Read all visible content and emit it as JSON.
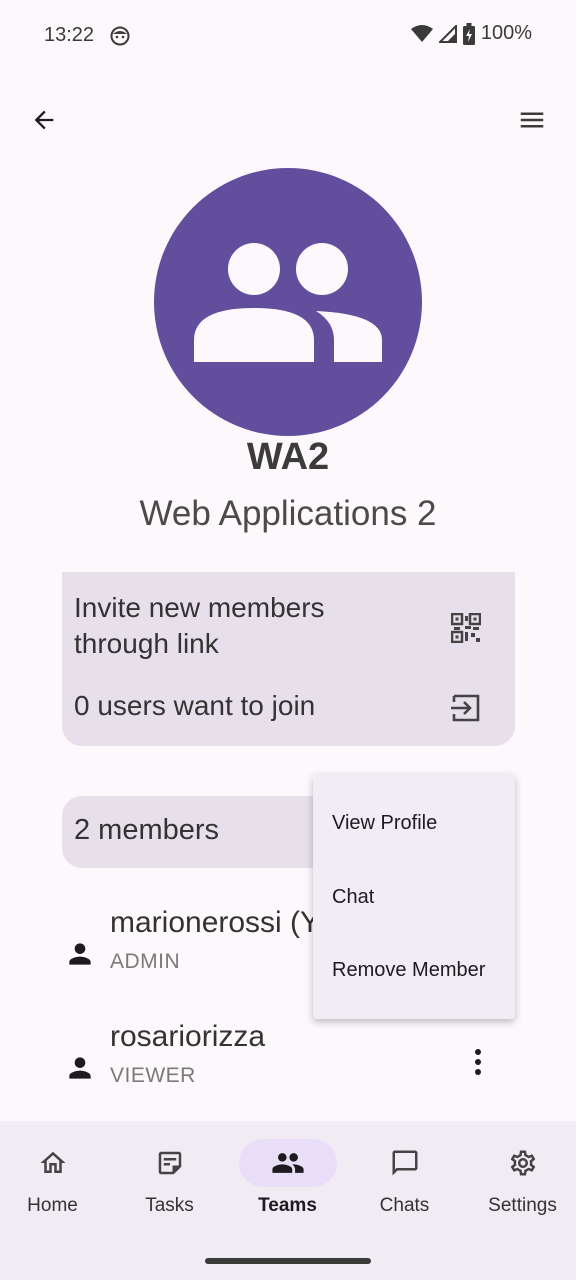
{
  "status_bar": {
    "time": "13:22",
    "battery": "100%"
  },
  "team": {
    "code": "WA2",
    "name": "Web Applications 2"
  },
  "invite": {
    "title": "Invite new members through link",
    "join_requests": "0 users want to join"
  },
  "members": {
    "count_label": "2 members",
    "list": [
      {
        "name": "marionerossi (Y",
        "role": "ADMIN"
      },
      {
        "name": "rosariorizza",
        "role": "VIEWER"
      }
    ]
  },
  "context_menu": {
    "items": [
      "View Profile",
      "Chat",
      "Remove Member"
    ]
  },
  "nav": {
    "items": [
      {
        "label": "Home",
        "icon": "home-icon"
      },
      {
        "label": "Tasks",
        "icon": "tasks-icon"
      },
      {
        "label": "Teams",
        "icon": "teams-icon",
        "active": true
      },
      {
        "label": "Chats",
        "icon": "chat-bubble-icon"
      },
      {
        "label": "Settings",
        "icon": "gear-icon"
      }
    ]
  },
  "colors": {
    "avatar": "#614f9e",
    "card": "#e7e0eb",
    "nav_active": "#e8def8"
  }
}
